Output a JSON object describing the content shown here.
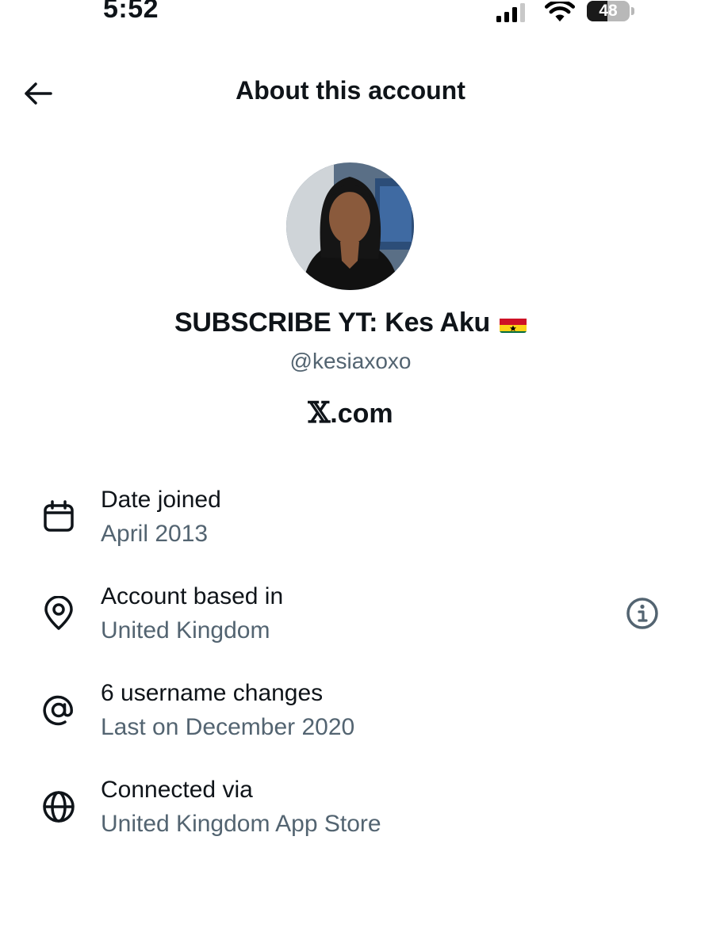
{
  "status_bar": {
    "time": "5:52",
    "battery_level": "48",
    "battery_fraction": 0.48
  },
  "header": {
    "title": "About this account",
    "back_icon": "arrow-left-icon"
  },
  "profile": {
    "display_name": "SUBSCRIBE YT: Kes Aku",
    "flag": "ghana-flag",
    "handle": "@kesiaxoxo",
    "site_logo": "𝕏",
    "site_suffix": ".com"
  },
  "details": [
    {
      "icon": "calendar-icon",
      "title": "Date joined",
      "value": "April 2013"
    },
    {
      "icon": "location-pin-icon",
      "title": "Account based in",
      "value": "United Kingdom",
      "action_icon": "info-icon"
    },
    {
      "icon": "at-sign-icon",
      "title": "6 username changes",
      "value": "Last on December 2020"
    },
    {
      "icon": "globe-icon",
      "title": "Connected via",
      "value": "United Kingdom App Store"
    }
  ],
  "colors": {
    "primary_text": "#0f1419",
    "secondary_text": "#536471",
    "background": "#ffffff"
  }
}
